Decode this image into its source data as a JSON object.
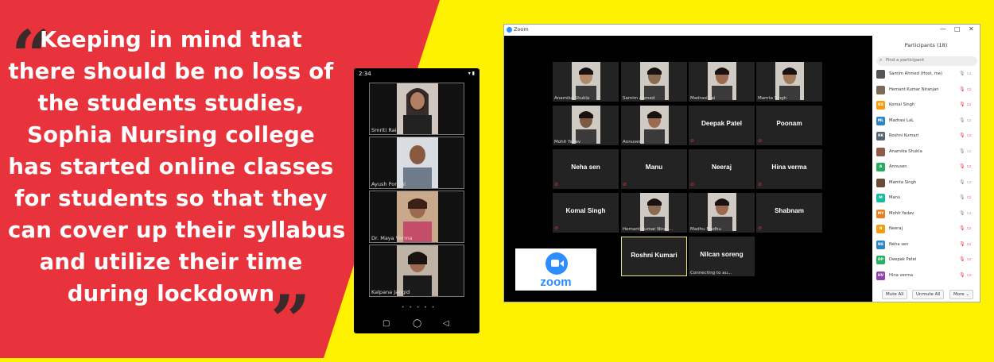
{
  "quote": {
    "open": "“",
    "close": "”",
    "lines": [
      "Keeping in mind that",
      "there should be no loss of",
      "the students studies,",
      "Sophia Nursing college",
      "has started online classes",
      "for students so that they",
      "can cover up their syllabus",
      "and utilize their time",
      "during lockdown"
    ]
  },
  "phone": {
    "time": "2:34",
    "participants": [
      "Smriti Rai",
      "Ayush Porwal",
      "Dr. Maya Verma",
      "Kalpana Jangid"
    ],
    "nav": {
      "back": "◁",
      "home": "◯",
      "recents": "▢"
    }
  },
  "zoom": {
    "title": "Zoom",
    "window_controls": {
      "minimize": "—",
      "maximize": "□",
      "close": "✕"
    },
    "tiles": [
      {
        "name": "Anamika Shukla",
        "label": ""
      },
      {
        "name": "Samim Ahmed",
        "label": ""
      },
      {
        "name": "Madrasi Lal",
        "label": ""
      },
      {
        "name": "Mamta Singh",
        "label": ""
      },
      {
        "name": "Mohit Yadav",
        "label": ""
      },
      {
        "name": "Annusen",
        "label": ""
      },
      {
        "name": "",
        "label": "Deepak Patel"
      },
      {
        "name": "",
        "label": "Poonam"
      },
      {
        "name": "",
        "label": "Neha sen"
      },
      {
        "name": "",
        "label": "Manu"
      },
      {
        "name": "",
        "label": "Neeraj"
      },
      {
        "name": "",
        "label": "Hina verma"
      },
      {
        "name": "",
        "label": "Komal Singh"
      },
      {
        "name": "Hemant Kumar Niran...",
        "label": ""
      },
      {
        "name": "Madhu Madhu",
        "label": ""
      },
      {
        "name": "",
        "label": "Shabnam"
      },
      {
        "name": "",
        "label": "Roshni Kumari"
      },
      {
        "name": "Connecting to au...",
        "label": "Nilcan soreng"
      }
    ],
    "logo_text": "zoom",
    "panel": {
      "title": "Participants (18)",
      "search_placeholder": "Find a participant",
      "participants": [
        {
          "name": "Samim Ahmed (Host, me)",
          "initials": "",
          "color": "#555555",
          "mic_muted": false,
          "video_off": false
        },
        {
          "name": "Hemant Kumar Niranjan",
          "initials": "",
          "color": "#7a6a5a",
          "mic_muted": true,
          "video_off": true
        },
        {
          "name": "Komal Singh",
          "initials": "KS",
          "color": "#f39c12",
          "mic_muted": true,
          "video_off": true
        },
        {
          "name": "Madrasi LaL",
          "initials": "ML",
          "color": "#2e86c1",
          "mic_muted": false,
          "video_off": false
        },
        {
          "name": "Roshni Kumari",
          "initials": "RK",
          "color": "#566573",
          "mic_muted": true,
          "video_off": true
        },
        {
          "name": "Anamika Shukla",
          "initials": "",
          "color": "#8e5a4a",
          "mic_muted": false,
          "video_off": false
        },
        {
          "name": "Annusen",
          "initials": "A",
          "color": "#27ae60",
          "mic_muted": true,
          "video_off": true
        },
        {
          "name": "Mamta Singh",
          "initials": "",
          "color": "#6b4a3a",
          "mic_muted": false,
          "video_off": false
        },
        {
          "name": "Manu",
          "initials": "M",
          "color": "#1abc9c",
          "mic_muted": false,
          "video_off": true
        },
        {
          "name": "Mohit Yadav",
          "initials": "MY",
          "color": "#e67e22",
          "mic_muted": false,
          "video_off": false
        },
        {
          "name": "Neeraj",
          "initials": "N",
          "color": "#f39c12",
          "mic_muted": true,
          "video_off": true
        },
        {
          "name": "Neha sen",
          "initials": "NS",
          "color": "#2e86c1",
          "mic_muted": true,
          "video_off": true
        },
        {
          "name": "Deepak Patel",
          "initials": "DP",
          "color": "#27ae60",
          "mic_muted": true,
          "video_off": true
        },
        {
          "name": "Hina verma",
          "initials": "HV",
          "color": "#8e44ad",
          "mic_muted": true,
          "video_off": true
        }
      ],
      "buttons": {
        "mute_all": "Mute All",
        "unmute_all": "Unmute All",
        "more": "More ⌄"
      }
    }
  }
}
